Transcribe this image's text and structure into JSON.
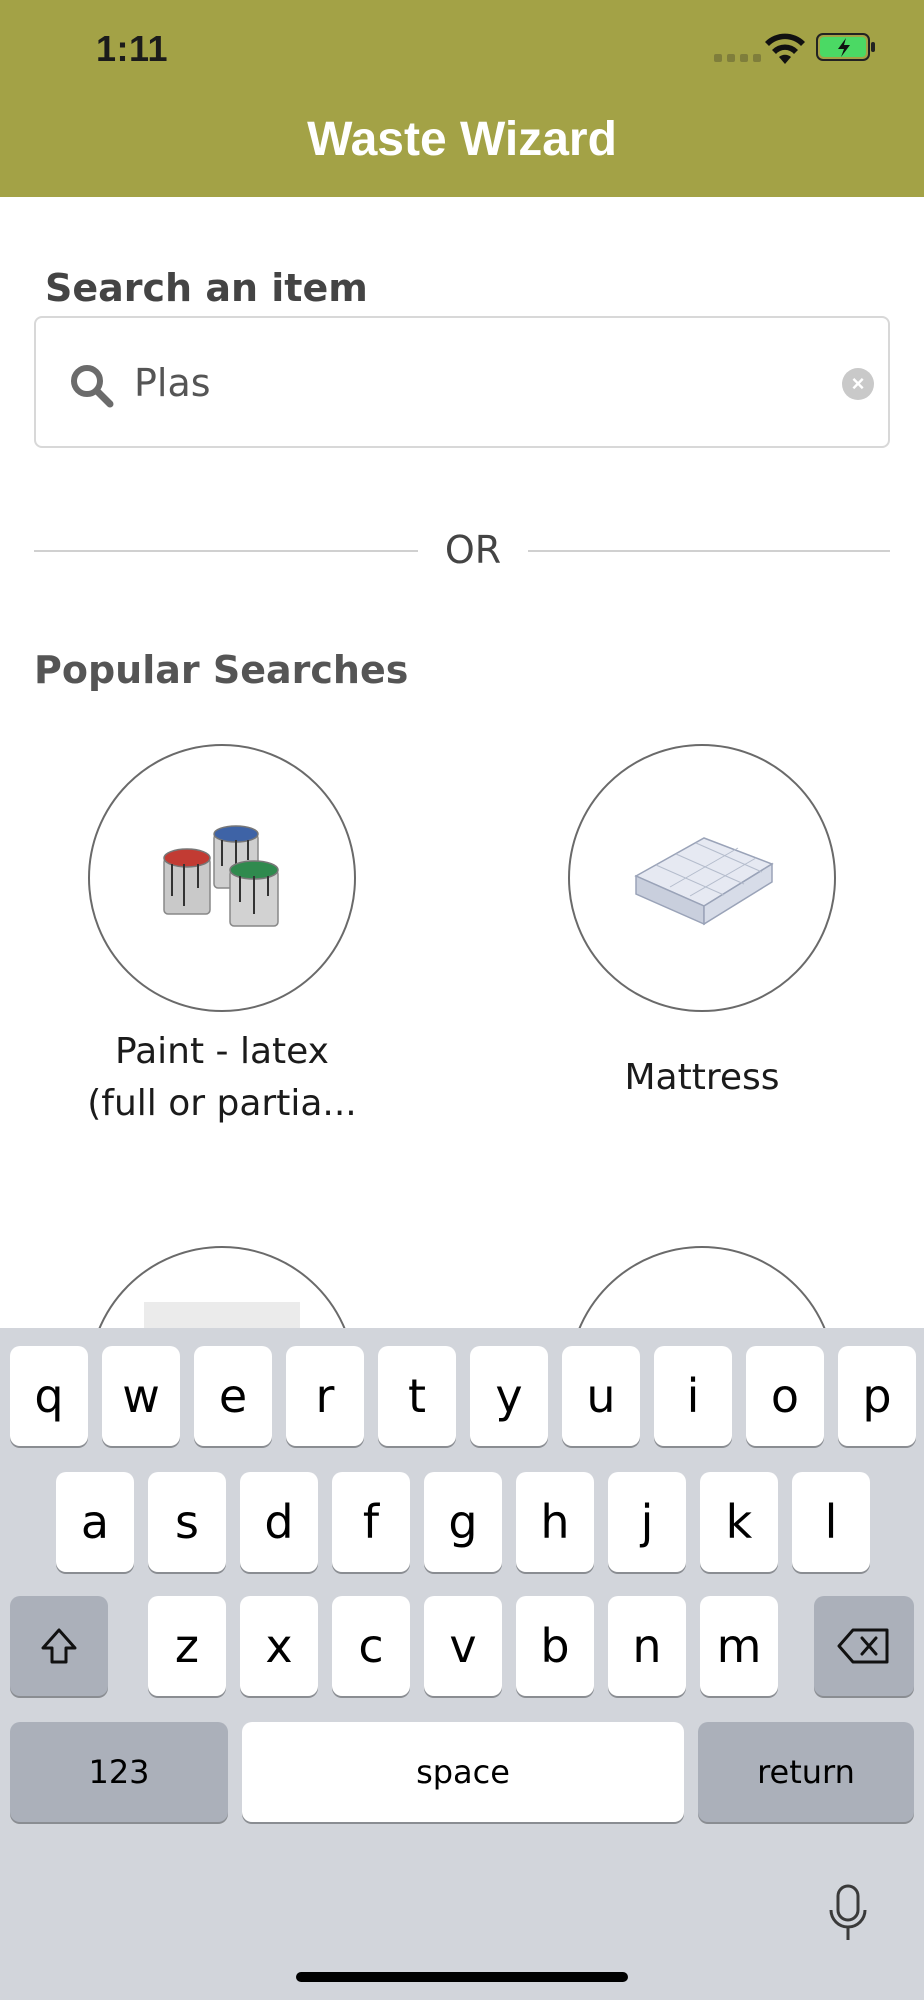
{
  "status_bar": {
    "time": "1:11"
  },
  "header": {
    "title": "Waste Wizard",
    "background_color": "#a3a246"
  },
  "search": {
    "label": "Search an item",
    "value": "Plas",
    "clear_icon": "clear-circle-icon",
    "search_icon": "magnifier-icon"
  },
  "divider": {
    "text": "OR"
  },
  "popular": {
    "title": "Popular Searches",
    "items": [
      {
        "line1": "Paint - latex",
        "line2": "(full or partia...",
        "icon": "paint-cans-image"
      },
      {
        "line1": "Mattress",
        "line2": "",
        "icon": "mattress-image"
      },
      {
        "line1": "",
        "line2": "",
        "icon": "item-image"
      },
      {
        "line1": "",
        "line2": "",
        "icon": "item-image"
      }
    ]
  },
  "keyboard": {
    "row1": [
      "q",
      "w",
      "e",
      "r",
      "t",
      "y",
      "u",
      "i",
      "o",
      "p"
    ],
    "row2": [
      "a",
      "s",
      "d",
      "f",
      "g",
      "h",
      "j",
      "k",
      "l"
    ],
    "row3": [
      "z",
      "x",
      "c",
      "v",
      "b",
      "n",
      "m"
    ],
    "numbers_key": "123",
    "space_key": "space",
    "return_key": "return",
    "shift_icon": "shift-icon",
    "delete_icon": "backspace-icon",
    "mic_icon": "microphone-icon"
  }
}
